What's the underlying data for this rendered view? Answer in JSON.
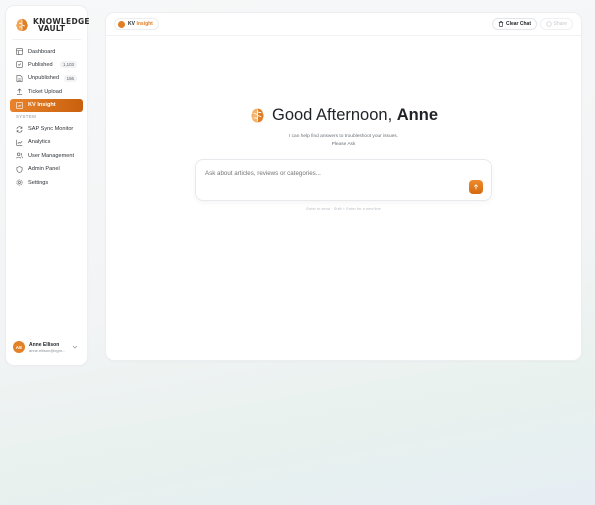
{
  "sidebar": {
    "logo": {
      "line1": "KNOWLEDGE",
      "line2": "VAULT"
    },
    "items": [
      {
        "label": "Dashboard",
        "icon": "grid-icon"
      },
      {
        "label": "Published",
        "icon": "doc-check-icon",
        "count": "1,103"
      },
      {
        "label": "Unpublished",
        "icon": "doc-icon",
        "count": "156"
      },
      {
        "label": "Ticket Upload",
        "icon": "upload-icon"
      },
      {
        "label": "KV Insight",
        "icon": "insight-icon",
        "active": true
      }
    ],
    "section_label": "SYSTEM",
    "system_items": [
      {
        "label": "SAP Sync Monitor",
        "icon": "sync-icon"
      },
      {
        "label": "Analytics",
        "icon": "chart-icon"
      },
      {
        "label": "User Management",
        "icon": "users-icon"
      },
      {
        "label": "Admin Panel",
        "icon": "shield-icon"
      },
      {
        "label": "Settings",
        "icon": "gear-icon"
      }
    ],
    "user": {
      "initials": "AE",
      "name": "Anne Ellison",
      "email": "anne.ellison@cgm..."
    }
  },
  "header": {
    "chip_prefix": "KV",
    "chip_label": "Insight",
    "clear_label": "Clear Chat",
    "share_label": "Share"
  },
  "main": {
    "greeting_prefix": "Good Afternoon,",
    "greeting_name": "Anne",
    "sub_line1": "I can help find answers to troubleshoot your issues.",
    "sub_line2": "Please Ask",
    "input_placeholder": "Ask about articles, reviews or categories...",
    "hint": "Enter to send · Shift + Enter for a new line"
  },
  "colors": {
    "accent": "#e07f25",
    "accent_dark": "#c8600d"
  }
}
